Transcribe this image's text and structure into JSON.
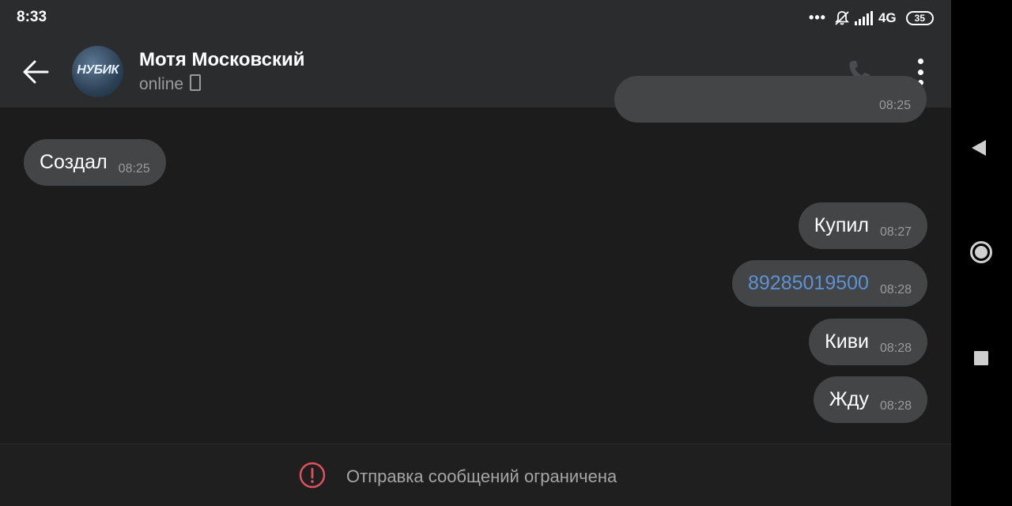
{
  "status_bar": {
    "time": "8:33",
    "dots": "•••",
    "network": "4G",
    "battery": "35"
  },
  "header": {
    "contact_name": "Мотя Московский",
    "status": "online",
    "avatar_text": "НУБИК",
    "icons": [
      "arrow-left-icon",
      "phone-icon",
      "more-vertical-icon"
    ]
  },
  "messages": [
    {
      "side": "out",
      "text": "",
      "time": "08:25"
    },
    {
      "side": "in",
      "text": "Создал",
      "time": "08:25"
    },
    {
      "side": "out",
      "text": "Купил",
      "time": "08:27"
    },
    {
      "side": "out",
      "text": "89285019500",
      "time": "08:28",
      "link": true
    },
    {
      "side": "out",
      "text": "Киви",
      "time": "08:28"
    },
    {
      "side": "out",
      "text": "Жду",
      "time": "08:28"
    }
  ],
  "composer": {
    "restricted_text": "Отправка сообщений ограничена",
    "icon": "alert-circle-icon"
  },
  "nav": {
    "icons": [
      "nav-back-icon",
      "nav-home-icon",
      "nav-recents-icon"
    ]
  },
  "colors": {
    "background": "#1c1c1d",
    "header": "#2b2c2e",
    "bubble": "#434547",
    "link": "#5b93d6",
    "warning": "#e0505e"
  }
}
